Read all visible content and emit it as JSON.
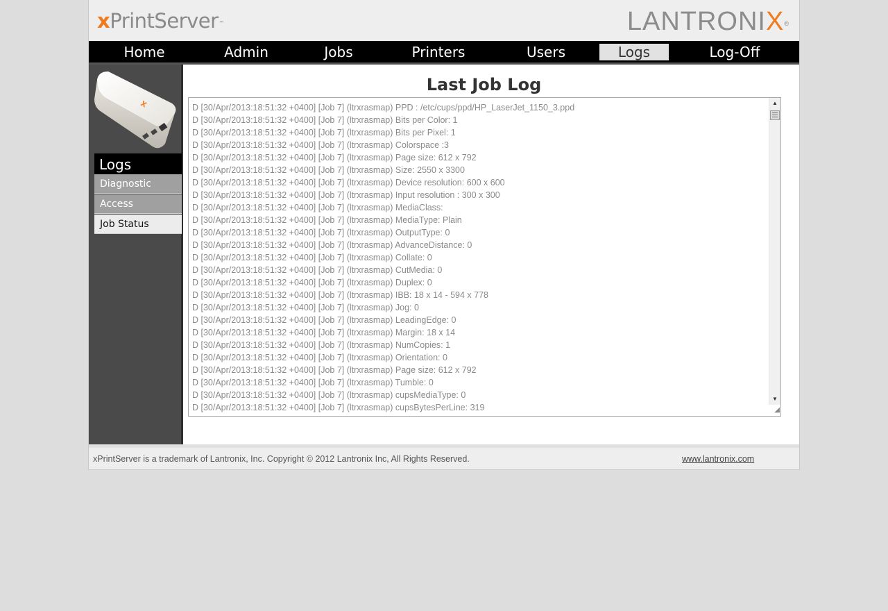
{
  "header": {
    "brand_x": "x",
    "brand_rest": "PrintServer",
    "brand_tm": "™",
    "vendor_main": "LANTRONI",
    "vendor_x": "X",
    "vendor_reg": "®"
  },
  "nav": {
    "items": [
      {
        "label": "Home"
      },
      {
        "label": "Admin"
      },
      {
        "label": "Jobs"
      },
      {
        "label": "Printers"
      },
      {
        "label": "Users"
      },
      {
        "label": "Logs"
      },
      {
        "label": "Log-Off"
      }
    ],
    "active": "Logs"
  },
  "sidebar": {
    "heading": "Logs",
    "items": [
      {
        "label": "Diagnostic"
      },
      {
        "label": "Access"
      },
      {
        "label": "Job Status"
      }
    ],
    "current": "Job Status"
  },
  "main": {
    "title": "Last Job Log",
    "log_lines": [
      "D [30/Apr/2013:18:51:32 +0400] [Job 7] (ltrxrasmap) PPD : /etc/cups/ppd/HP_LaserJet_1150_3.ppd",
      "D [30/Apr/2013:18:51:32 +0400] [Job 7] (ltrxrasmap) Bits per Color: 1",
      "D [30/Apr/2013:18:51:32 +0400] [Job 7] (ltrxrasmap) Bits per Pixel: 1",
      "D [30/Apr/2013:18:51:32 +0400] [Job 7] (ltrxrasmap) Colorspace :3",
      "D [30/Apr/2013:18:51:32 +0400] [Job 7] (ltrxrasmap) Page size: 612 x 792",
      "D [30/Apr/2013:18:51:32 +0400] [Job 7] (ltrxrasmap) Size: 2550 x 3300",
      "D [30/Apr/2013:18:51:32 +0400] [Job 7] (ltrxrasmap) Device resolution: 600 x 600",
      "D [30/Apr/2013:18:51:32 +0400] [Job 7] (ltrxrasmap) Input resolution : 300 x 300",
      "D [30/Apr/2013:18:51:32 +0400] [Job 7] (ltrxrasmap) MediaClass:",
      "D [30/Apr/2013:18:51:32 +0400] [Job 7] (ltrxrasmap) MediaType: Plain",
      "D [30/Apr/2013:18:51:32 +0400] [Job 7] (ltrxrasmap) OutputType: 0",
      "D [30/Apr/2013:18:51:32 +0400] [Job 7] (ltrxrasmap) AdvanceDistance: 0",
      "D [30/Apr/2013:18:51:32 +0400] [Job 7] (ltrxrasmap) Collate: 0",
      "D [30/Apr/2013:18:51:32 +0400] [Job 7] (ltrxrasmap) CutMedia: 0",
      "D [30/Apr/2013:18:51:32 +0400] [Job 7] (ltrxrasmap) Duplex: 0",
      "D [30/Apr/2013:18:51:32 +0400] [Job 7] (ltrxrasmap) IBB: 18 x 14 - 594 x 778",
      "D [30/Apr/2013:18:51:32 +0400] [Job 7] (ltrxrasmap) Jog: 0",
      "D [30/Apr/2013:18:51:32 +0400] [Job 7] (ltrxrasmap) LeadingEdge: 0",
      "D [30/Apr/2013:18:51:32 +0400] [Job 7] (ltrxrasmap) Margin: 18 x 14",
      "D [30/Apr/2013:18:51:32 +0400] [Job 7] (ltrxrasmap) NumCopies: 1",
      "D [30/Apr/2013:18:51:32 +0400] [Job 7] (ltrxrasmap) Orientation: 0",
      "D [30/Apr/2013:18:51:32 +0400] [Job 7] (ltrxrasmap) Page size: 612 x 792",
      "D [30/Apr/2013:18:51:32 +0400] [Job 7] (ltrxrasmap) Tumble: 0",
      "D [30/Apr/2013:18:51:32 +0400] [Job 7] (ltrxrasmap) cupsMediaType: 0",
      "D [30/Apr/2013:18:51:32 +0400] [Job 7] (ltrxrasmap) cupsBytesPerLine: 319"
    ]
  },
  "footer": {
    "copyright": "xPrintServer is a trademark of Lantronix, Inc. Copyright © 2012 Lantronix Inc, All Rights Reserved.",
    "link": "www.lantronix.com"
  },
  "colors": {
    "accent_orange": "#ef7b1e",
    "nav_bg": "#000000",
    "sidebar_bg": "#4a4a4a",
    "log_text": "#8a8a8a"
  },
  "icons": {
    "scroll_up": "triangle-up-icon",
    "scroll_down": "triangle-down-icon",
    "resize": "resize-grip-icon"
  }
}
